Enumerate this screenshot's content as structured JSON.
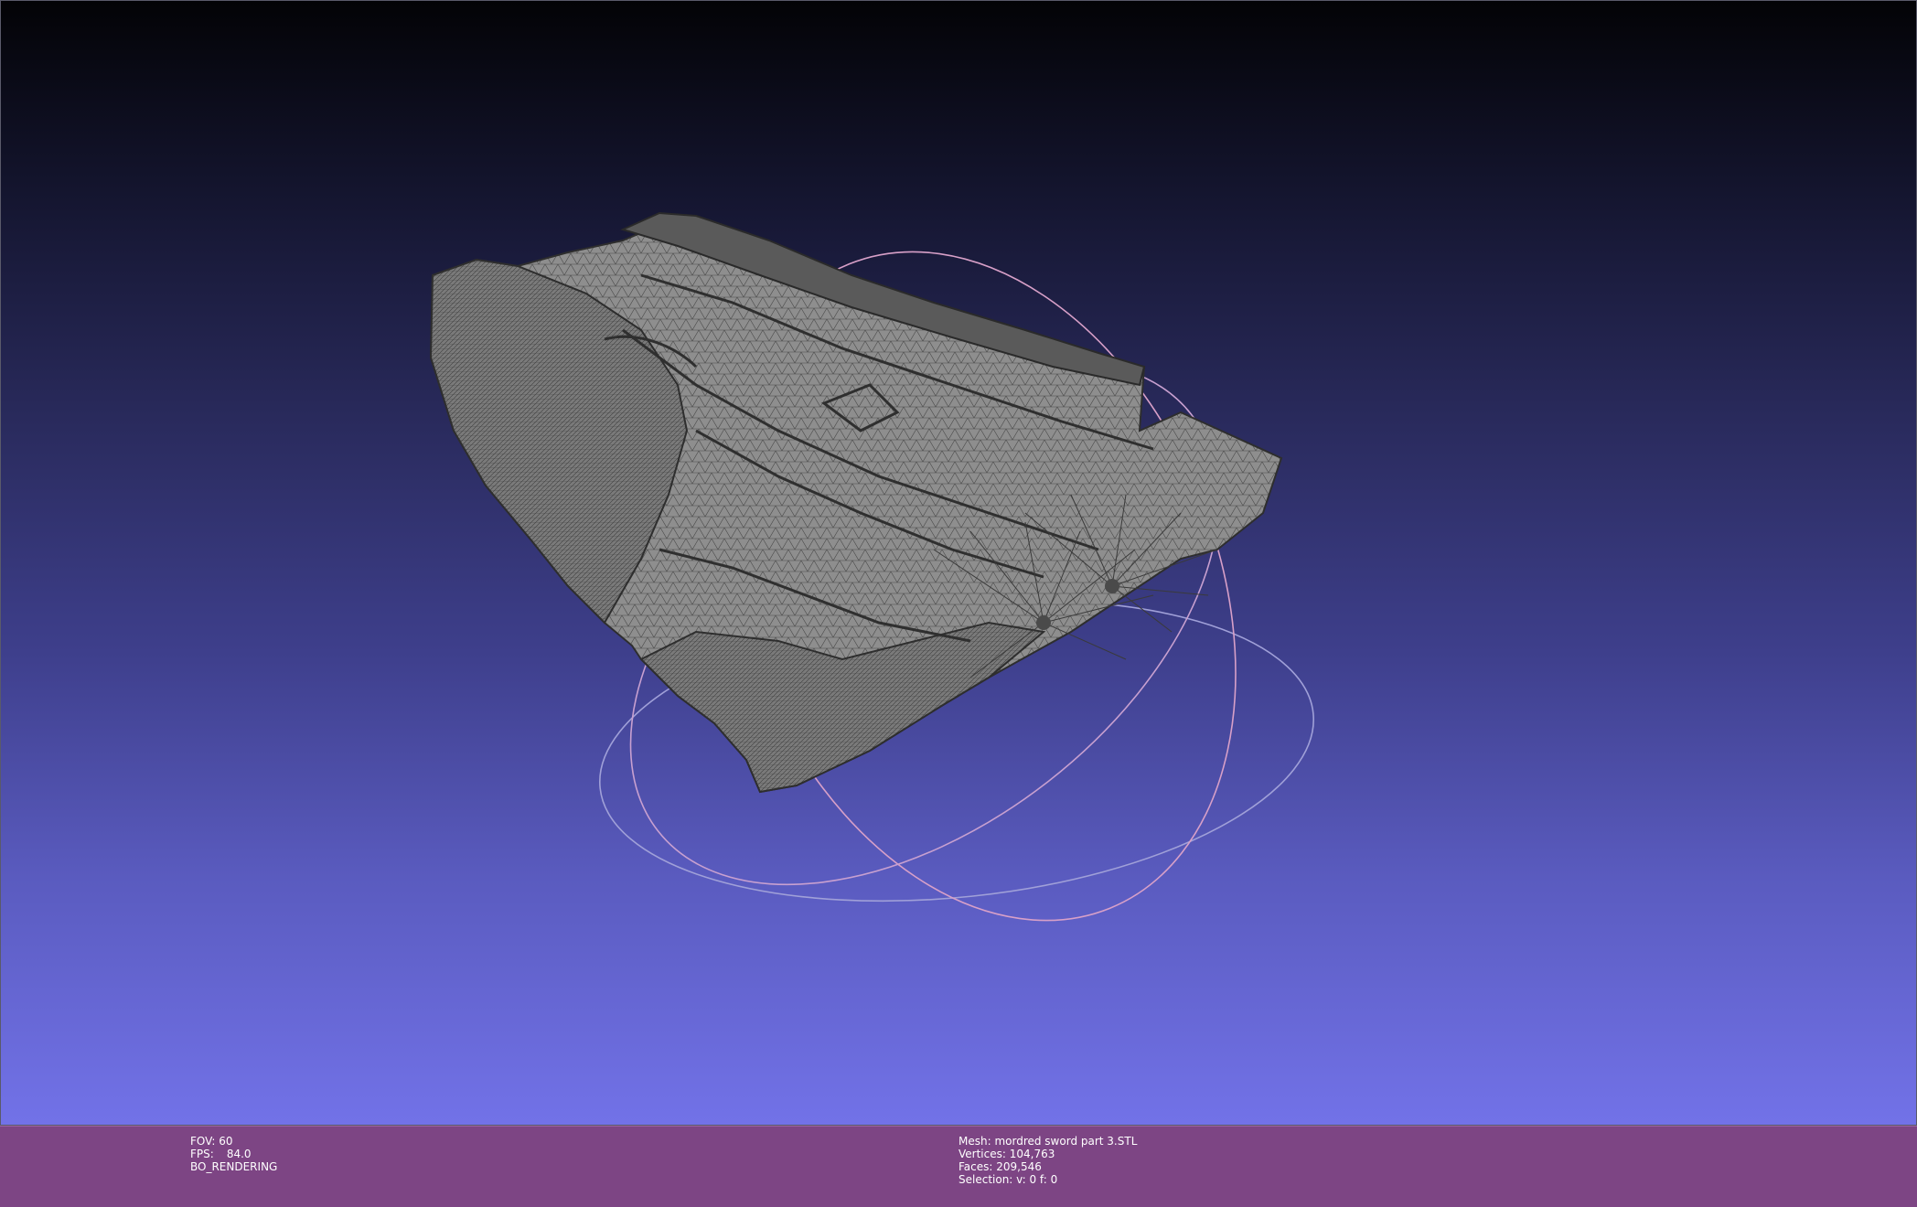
{
  "viewer": {
    "background_top": "#030306",
    "background_bottom": "#7272e8",
    "mesh_color": "#8c8c8c",
    "wire_color": "#3a3a3a",
    "trackball_colors": [
      "#c8a0c8",
      "#a0a0d8",
      "#d8a0c0"
    ]
  },
  "status_left": {
    "fov": "FOV: 60",
    "fps_label": "FPS:",
    "fps_value": "84.0",
    "mode": "BO_RENDERING"
  },
  "status_right": {
    "mesh": "Mesh: mordred sword part 3.STL",
    "vertices": "Vertices: 104,763",
    "faces": "Faces: 209,546",
    "selection": "Selection: v: 0 f: 0"
  }
}
